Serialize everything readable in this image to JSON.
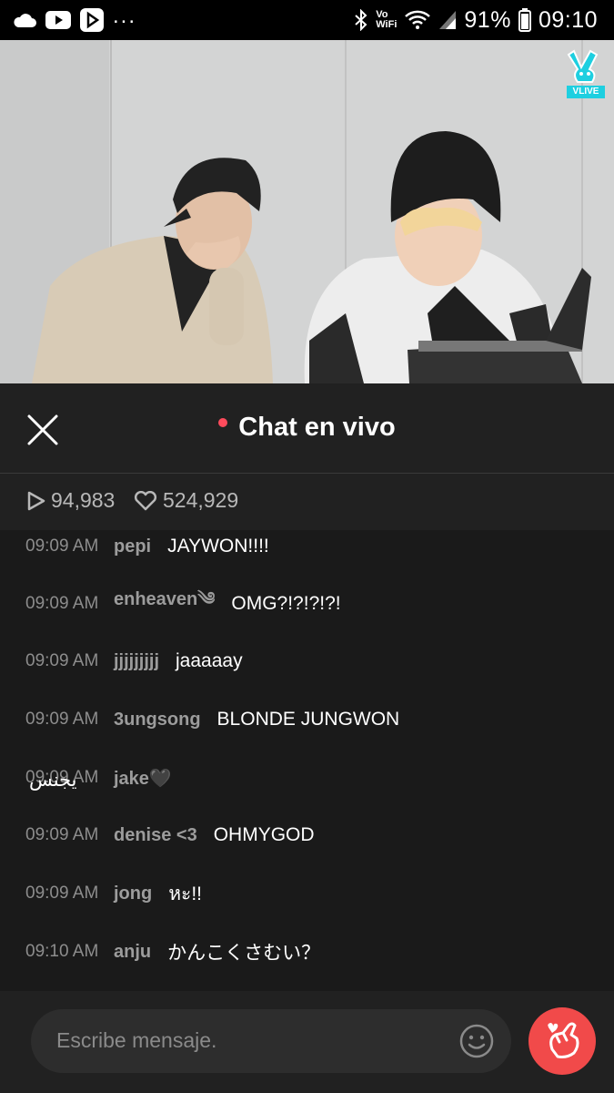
{
  "status_bar": {
    "wifi_label_top": "Vo",
    "wifi_label_bottom": "WiFi",
    "battery": "91%",
    "time": "09:10",
    "more": "..."
  },
  "video": {
    "logo_text": "VLIVE"
  },
  "chat": {
    "title": "Chat en vivo",
    "views": "94,983",
    "likes": "524,929",
    "messages": [
      {
        "time": "09:09 AM",
        "user": "pepi",
        "text": "JAYWON!!!!"
      },
      {
        "time": "09:09 AM",
        "user": "enheaven༄",
        "text": "OMG?!?!?!?!"
      },
      {
        "time": "09:09 AM",
        "user": "jjjjjjjjj",
        "text": "jaaaaay"
      },
      {
        "time": "09:09 AM",
        "user": "3ungsong",
        "text": "BLONDE JUNGWON"
      },
      {
        "time": "09:09 AM",
        "user": "jake🖤",
        "text": "يجنس"
      },
      {
        "time": "09:09 AM",
        "user": "denise <3",
        "text": "OHMYGOD"
      },
      {
        "time": "09:09 AM",
        "user": "jong",
        "text": "หะ!!"
      },
      {
        "time": "09:10 AM",
        "user": "anju",
        "text": "かんこくさむい？"
      }
    ],
    "input_placeholder": "Escribe mensaje."
  }
}
